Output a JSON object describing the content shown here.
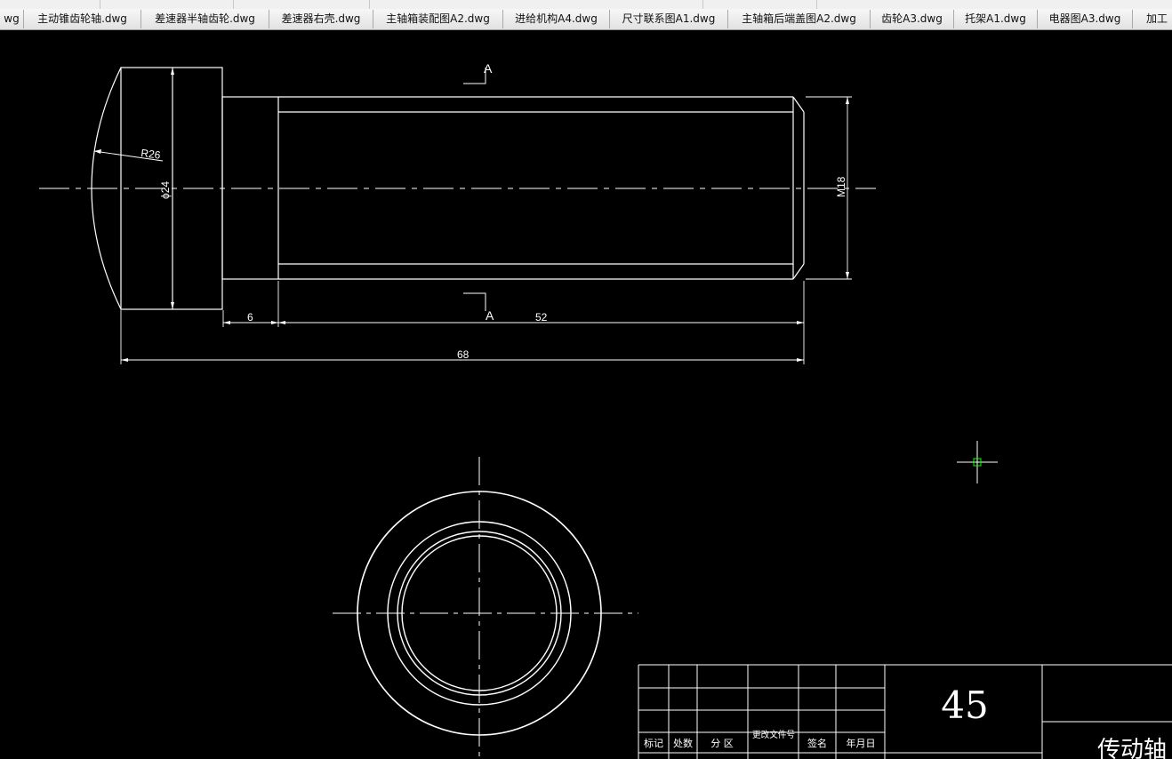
{
  "tabs": [
    {
      "label": "wg"
    },
    {
      "label": "主动锥齿轮轴.dwg"
    },
    {
      "label": "差速器半轴齿轮.dwg"
    },
    {
      "label": "差速器右壳.dwg"
    },
    {
      "label": "主轴箱装配图A2.dwg"
    },
    {
      "label": "进给机构A4.dwg"
    },
    {
      "label": "尺寸联系图A1.dwg"
    },
    {
      "label": "主轴箱后端盖图A2.dwg"
    },
    {
      "label": "齿轮A3.dwg"
    },
    {
      "label": "托架A1.dwg"
    },
    {
      "label": "电器图A3.dwg"
    },
    {
      "label": "加工"
    }
  ],
  "drawing": {
    "section_label_top": "A",
    "section_label_bottom": "A",
    "radius_label": "R26",
    "diameter_label": "ϕ24",
    "thread_label": "M18",
    "dim_6": "6",
    "dim_52": "52",
    "dim_68": "68"
  },
  "title_block": {
    "material": "45",
    "part_name": "传动轴",
    "headers": [
      "标记",
      "处数",
      "分 区",
      "更改文件号",
      "签名",
      "年月日"
    ]
  },
  "colors": {
    "background": "#000000",
    "lines": "#ffffff",
    "cursor": "#00ff00"
  }
}
